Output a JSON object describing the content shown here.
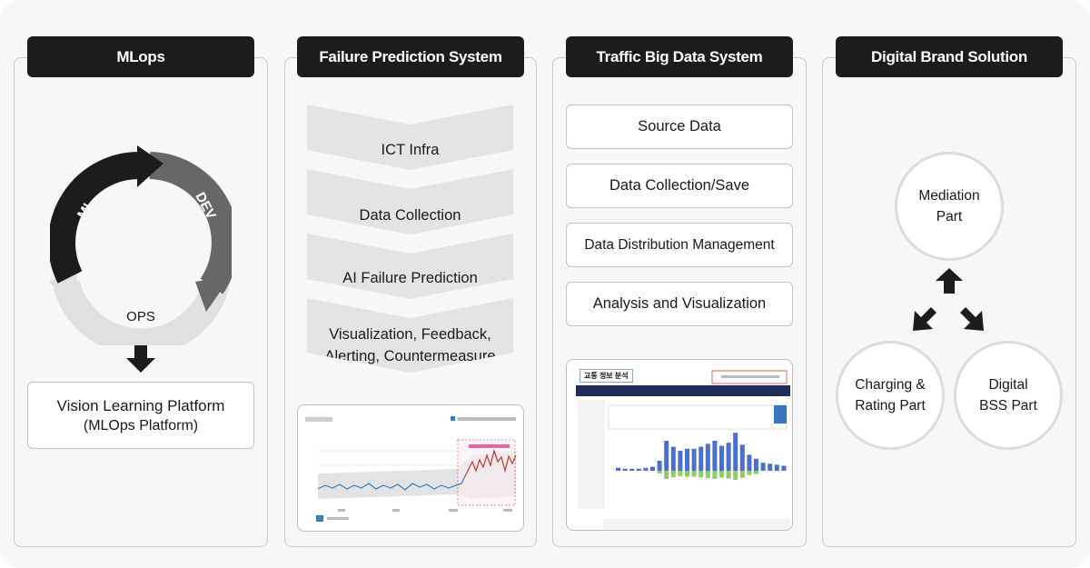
{
  "columns": [
    {
      "title": "MLops",
      "cycle": [
        "ML",
        "DEV",
        "OPS"
      ],
      "platform_line1": "Vision Learning Platform",
      "platform_line2": "(MLOps Platform)"
    },
    {
      "title": "Failure Prediction System",
      "steps": [
        "ICT Infra",
        "Data Collection",
        "AI Failure Prediction",
        "Visualization, Feedback,\nAlerting, Countermeasure"
      ]
    },
    {
      "title": "Traffic Big Data System",
      "steps": [
        "Source Data",
        "Data Collection/Save",
        "Data Distribution Management",
        "Analysis and Visualization"
      ],
      "screenshot_label": "교통 정보 분석"
    },
    {
      "title": "Digital Brand Solution",
      "parts": [
        "Mediation\nPart",
        "Charging &\nRating Part",
        "Digital\nBSS Part"
      ]
    }
  ],
  "colors": {
    "pill": "#1c1c1c",
    "ml": "#1c1c1c",
    "dev": "#676767",
    "ops": "#e0e0e0",
    "chevron": "#e4e4e4",
    "anomaly": "#e0287a",
    "series": "#2b7fc4",
    "anomaly_series": "#c0392b",
    "bar_blue": "#4a6fd0",
    "bar_green": "#8ccc6a"
  }
}
